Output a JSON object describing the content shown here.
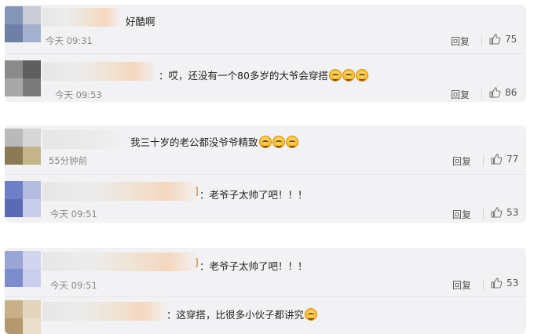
{
  "comments": [
    {
      "text": "好酷啊",
      "emojis": 0,
      "time": "今天 09:31",
      "reply_label": "回复",
      "likes": "75",
      "avatar_colors": [
        "#8596b8",
        "#c9cbd6",
        "#6f7fa6",
        "#a3b1cf"
      ]
    },
    {
      "text": "：哎，还没有一个80多岁的大爷会穿搭",
      "emojis": 3,
      "time": "今天 09:53",
      "reply_label": "回复",
      "likes": "86",
      "avatar_colors": [
        "#8b8b8b",
        "#5e5e5e",
        "#a8a8a8",
        "#7a7a7a"
      ]
    },
    {
      "text": "我三十岁的老公都没爷爷精致",
      "emojis": 3,
      "time": "55分钟前",
      "reply_label": "回复",
      "likes": "77",
      "avatar_colors": [
        "#b9b9b9",
        "#d7d7d7",
        "#8b7a55",
        "#c4b48b"
      ]
    },
    {
      "text": "：老爷子太帅了吧！！！",
      "emojis": 0,
      "time": "今天 09:51",
      "reply_label": "回复",
      "likes": "53",
      "avatar_colors": [
        "#6e7fc7",
        "#b3bce0",
        "#5a6ab5",
        "#c7cde9"
      ]
    },
    {
      "text": "：老爷子太帅了吧！！！",
      "emojis": 0,
      "time": "今天 09:51",
      "reply_label": "回复",
      "likes": "53",
      "avatar_colors": [
        "#9aa6d6",
        "#d1d6ee",
        "#7d8cca",
        "#c9cfea"
      ]
    },
    {
      "text": "：这穿搭，比很多小伙子都讲究",
      "emojis": 1,
      "time": "",
      "reply_label": "",
      "likes": "",
      "avatar_colors": [
        "#c7b08a",
        "#e3d6bd",
        "#b39870",
        "#e9dec9"
      ]
    }
  ]
}
